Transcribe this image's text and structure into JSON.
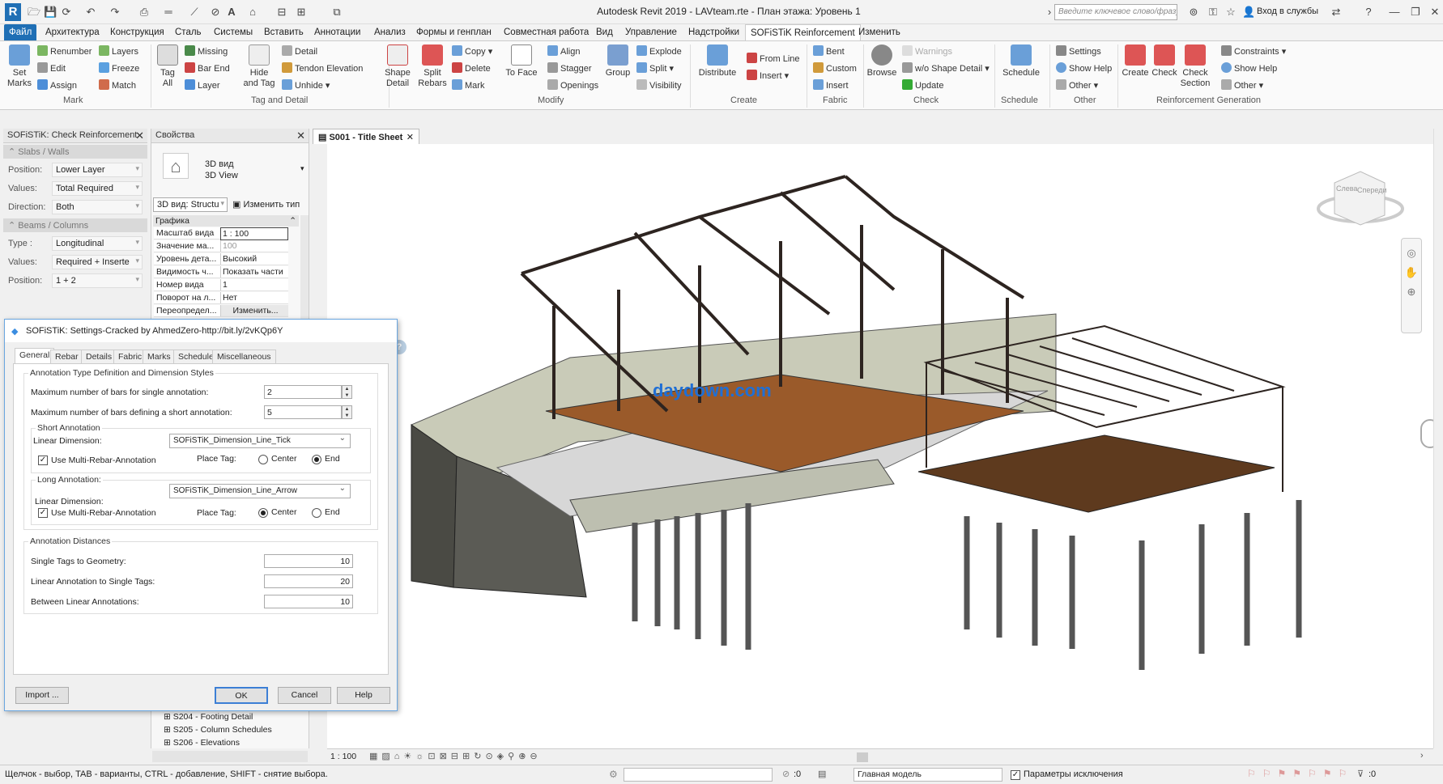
{
  "window": {
    "title": "Autodesk Revit 2019 -  LAVteam.rte - План этажа: Уровень 1",
    "search_placeholder": "Введите ключевое слово/фразу",
    "login": "Вход в службы"
  },
  "menu": {
    "file": "Файл",
    "tabs": [
      "Архитектура",
      "Конструкция",
      "Сталь",
      "Системы",
      "Вставить",
      "Аннотации",
      "Анализ",
      "Формы и генплан",
      "Совместная работа",
      "Вид",
      "Управление",
      "Надстройки",
      "SOFiSTiK Reinforcement",
      "Изменить"
    ]
  },
  "ribbon": {
    "mark": {
      "set_marks": "Set Marks",
      "renumber": "Renumber",
      "edit": "Edit",
      "assign": "Assign",
      "layers": "Layers",
      "freeze": "Freeze",
      "match": "Match",
      "label": "Mark"
    },
    "tag": {
      "tag_all": "Tag All",
      "missing": "Missing",
      "bar_end": "Bar End",
      "layer": "Layer",
      "hide_and_tag": "Hide and Tag",
      "detail": "Detail",
      "tendon_elevation": "Tendon Elevation",
      "unhide": "Unhide",
      "label": "Tag and Detail"
    },
    "modify": {
      "shape_detail": "Shape Detail",
      "split_rebars": "Split Rebars",
      "copy": "Copy",
      "delete": "Delete",
      "mark": "Mark",
      "to_face": "To Face",
      "align": "Align",
      "stagger": "Stagger",
      "openings": "Openings",
      "group": "Group",
      "explode": "Explode",
      "split": "Split",
      "visibility": "Visibility",
      "label": "Modify"
    },
    "create": {
      "distribute": "Distribute",
      "from_line": "From Line",
      "insert": "Insert",
      "label": "Create"
    },
    "fabric": {
      "bent": "Bent",
      "custom": "Custom",
      "insert": "Insert",
      "label": "Fabric"
    },
    "check": {
      "browse": "Browse",
      "warnings": "Warnings",
      "shape_detail": "w/o Shape Detail",
      "update": "Update",
      "label": "Check"
    },
    "schedule": {
      "schedule": "Schedule",
      "label": "Schedule"
    },
    "other": {
      "settings": "Settings",
      "show_help": "Show Help",
      "other": "Other",
      "label": "Other"
    },
    "reinf": {
      "create": "Create",
      "check": "Check",
      "check_section": "Check Section",
      "constraints": "Constraints",
      "show_help": "Show Help",
      "other": "Other",
      "label": "Reinforcement Generation"
    }
  },
  "check_panel": {
    "title": "SOFiSTiK: Check Reinforcement",
    "slabs_walls": "Slabs / Walls",
    "position_label": "Position:",
    "position_value": "Lower Layer",
    "values_label": "Values:",
    "values_value": "Total Required",
    "direction_label": "Direction:",
    "direction_value": "Both",
    "beams_columns": "Beams / Columns",
    "type_label": "Type :",
    "type_value": "Longitudinal",
    "values2_label": "Values:",
    "values2_value": "Required + Inserte",
    "position2_label": "Position:",
    "position2_value": "1 + 2"
  },
  "properties": {
    "title": "Свойства",
    "type_name1": "3D вид",
    "type_name2": "3D View",
    "selector": "3D вид: Structu",
    "edit_type": "Изменить тип",
    "section": "Графика",
    "rows": [
      {
        "k": "Масштаб вида",
        "v": "1 : 100"
      },
      {
        "k": "Значение ма...",
        "v": "100"
      },
      {
        "k": "Уровень дета...",
        "v": "Высокий"
      },
      {
        "k": "Видимость ч...",
        "v": "Показать части"
      },
      {
        "k": "Номер вида",
        "v": "1"
      },
      {
        "k": "Поворот на л...",
        "v": "Нет"
      },
      {
        "k": "Переопредел...",
        "v": "Изменить..."
      }
    ]
  },
  "browser": {
    "items": [
      "S204 - Footing Detail",
      "S205 - Column Schedules",
      "S206 - Elevations"
    ]
  },
  "view_tab": "S001 - Title Sheet",
  "watermark": "daydown.com",
  "dialog": {
    "title": "SOFiSTiK: Settings-Cracked by AhmedZero-http://bit.ly/2vKQp6Y",
    "tabs": [
      "General",
      "Rebar",
      "Details",
      "Fabric",
      "Marks",
      "Schedule",
      "Miscellaneous"
    ],
    "group1": "Annotation Type Definition and Dimension Styles",
    "max_single_label": "Maximum number of bars for single annotation:",
    "max_single": "2",
    "max_short_label": "Maximum number of bars defining a short annotation:",
    "max_short": "5",
    "short_annotation": "Short Annotation",
    "linear_dim_label": "Linear Dimension:",
    "short_dim": "SOFiSTiK_Dimension_Line_Tick",
    "multi_rebar": "Use Multi-Rebar-Annotation",
    "place_tag": "Place Tag:",
    "center": "Center",
    "end": "End",
    "long_annotation": "Long Annotation:",
    "long_dim": "SOFiSTiK_Dimension_Line_Arrow",
    "group2": "Annotation Distances",
    "single_tags_label": "Single Tags to Geometry:",
    "single_tags": "10",
    "linear_single_label": "Linear Annotation to Single Tags:",
    "linear_single": "20",
    "between_label": "Between Linear Annotations:",
    "between": "10",
    "import": "Import ...",
    "ok": "OK",
    "cancel": "Cancel",
    "help": "Help"
  },
  "view_scale": "1 : 100",
  "status": {
    "hint": "Щелчок - выбор, TAB - варианты, CTRL - добавление, SHIFT - снятие выбора.",
    "zero": ":0",
    "model": "Главная модель",
    "exclusions": "Параметры исключения",
    "filter": ":0"
  },
  "viewcube": {
    "left": "Слева",
    "front": "Спереди"
  }
}
